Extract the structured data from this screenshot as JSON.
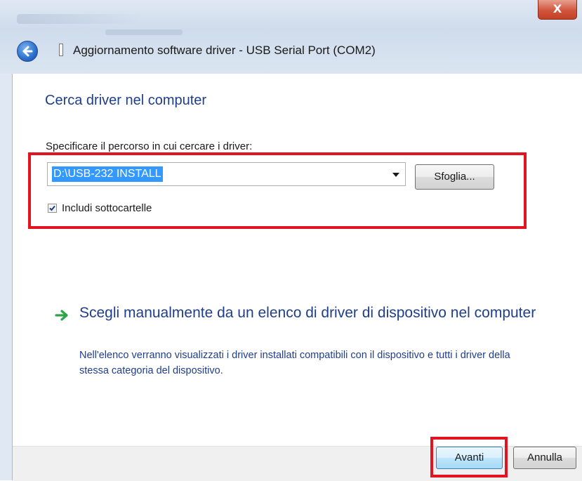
{
  "window": {
    "title": "Aggiornamento software driver - USB Serial Port (COM2)",
    "close_glyph": "X"
  },
  "main": {
    "heading": "Cerca driver nel computer",
    "path_label": "Specificare il percorso in cui cercare i driver:",
    "path_value": "D:\\USB-232 INSTALL",
    "browse_label": "Sfoglia...",
    "include_subfolders_label": "Includi sottocartelle",
    "include_subfolders_checked": true
  },
  "manual_option": {
    "title": "Scegli manualmente da un elenco di driver di dispositivo nel computer",
    "description": "Nell'elenco verranno visualizzati i driver installati compatibili con il dispositivo e tutti i driver della stessa categoria del dispositivo.",
    "icon": "green-arrow-icon"
  },
  "footer": {
    "next_label": "Avanti",
    "cancel_label": "Annulla"
  },
  "colors": {
    "heading": "#1e3e8c",
    "highlight_box": "#e2141f",
    "selection": "#3399ff"
  }
}
